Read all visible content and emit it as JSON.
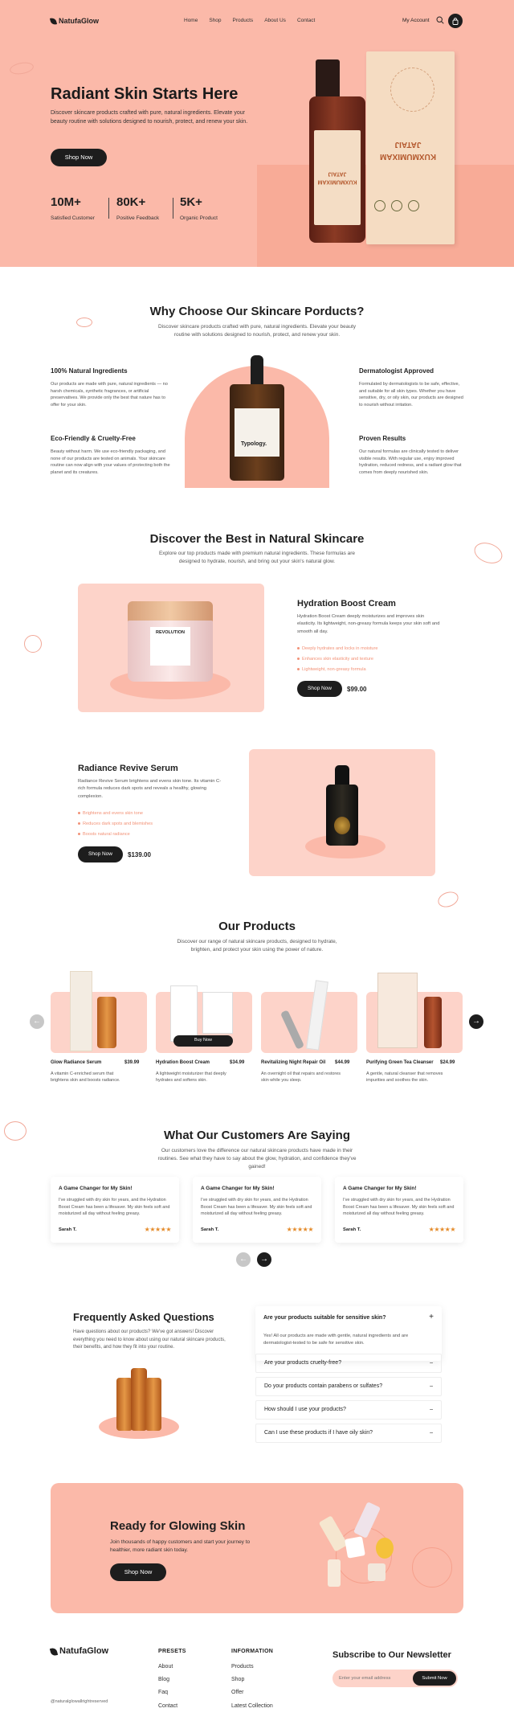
{
  "brand": "NatufaGlow",
  "nav": {
    "links": [
      "Home",
      "Shop",
      "Products",
      "About Us",
      "Contact"
    ],
    "account": "My Account"
  },
  "hero": {
    "title": "Radiant Skin Starts Here",
    "desc": "Discover skincare products crafted with pure, natural ingredients. Elevate your beauty routine with solutions designed to nourish, protect, and renew your skin.",
    "cta": "Shop Now",
    "stats": [
      {
        "num": "10M+",
        "label": "Satisfied  Customer"
      },
      {
        "num": "80K+",
        "label": "Positive Feedback"
      },
      {
        "num": "5K+",
        "label": "Organic Product"
      }
    ],
    "box_text": "KUXMUMIXAM JATAIJ"
  },
  "why": {
    "title": "Why Choose Our Skincare Porducts?",
    "sub": "Discover skincare products crafted with pure, natural ingredients. Elevate your beauty routine with solutions designed to nourish, protect, and renew your skin.",
    "features": [
      {
        "title": "100% Natural Ingredients",
        "text": "Our products are made with pure, natural ingredients — no harsh chemicals, synthetic fragrances, or artificial preservatives. We provide only the best that nature has to offer for your skin."
      },
      {
        "title": "Eco-Friendly & Cruelty-Free",
        "text": "Beauty without harm. We use eco-friendly packaging, and none of our products are tested on animals. Your skincare routine can now align with your values of protecting both the planet and its creatures."
      },
      {
        "title": "Dermatologist Approved",
        "text": "Formulated by dermatologists to be safe, effective, and suitable for all skin types. Whether you have sensitive, dry, or oily skin, our products are designed to nourish without irritation."
      },
      {
        "title": "Proven Results",
        "text": "Our natural formulas are clinically tested to deliver visible results. With regular use, enjoy improved hydration, reduced redness, and a radiant glow that comes from deeply nourished skin."
      }
    ],
    "bottle_label": "Typology."
  },
  "discover": {
    "title": "Discover the Best in Natural Skincare",
    "sub": "Explore our top products made with premium natural ingredients. These formulas are designed to hydrate, nourish, and bring out your skin's natural glow.",
    "items": [
      {
        "name": "Hydration Boost Cream",
        "desc": "Hydration Boost Cream deeply moisturizes and improves skin elasticity. Its lightweight, non-greasy formula keeps your skin soft and smooth all day.",
        "bullets": [
          "Deeply hydrates and locks in moisture",
          "Enhances skin elasticity and texture",
          "Lightweight, non-greasy formula"
        ],
        "cta": "Shop Now",
        "price": "$99.00",
        "jar_label": "REVOLUTION"
      },
      {
        "name": "Radiance Revive Serum",
        "desc": "Radiance Revive Serum brightens and evens skin tone. Its vitamin C-rich formula reduces dark spots and reveals a healthy, glowing complexion.",
        "bullets": [
          "Brightens and evens skin tone",
          "Reduces dark spots and blemishes",
          "Boosts natural radiance"
        ],
        "cta": "Shop Now",
        "price": "$139.00"
      }
    ]
  },
  "products": {
    "title": "Our Products",
    "sub": "Discover our range of natural skincare products, designed to hydrate, brighten, and protect your skin using the power of nature.",
    "buy": "Buy Now",
    "items": [
      {
        "name": "Glow Radiance Serum",
        "price": "$39.99",
        "desc": "A vitamin C-enriched serum that brightens skin and boosts radiance."
      },
      {
        "name": "Hydration Boost Cream",
        "price": "$34.99",
        "desc": "A lightweight moisturizer that deeply hydrates and softens skin."
      },
      {
        "name": "Revitalizing Night Repair Oil",
        "price": "$44.99",
        "desc": "An overnight oil that repairs and restores skin while you sleep."
      },
      {
        "name": "Purifying Green Tea Cleanser",
        "price": "$24.99",
        "desc": "A gentle, natural cleanser that removes impurities and soothes the skin."
      }
    ]
  },
  "reviews": {
    "title": "What Our Customers Are Saying",
    "sub": "Our customers love the difference our natural skincare products have made in their routines. See what they have to say about the glow, hydration, and confidence they've gained!",
    "items": [
      {
        "title": "A Game Changer for My Skin!",
        "text": "I've struggled with dry skin for years, and the Hydration Boost Cream has been a lifesaver. My skin feels soft and moisturized all day without feeling greasy.",
        "who": "Sarah T.",
        "stars": "★★★★★"
      },
      {
        "title": "A Game Changer for My Skin!",
        "text": "I've struggled with dry skin for years, and the Hydration Boost Cream has been a lifesaver. My skin feels soft and moisturized all day without feeling greasy.",
        "who": "Sarah T.",
        "stars": "★★★★★"
      },
      {
        "title": "A Game Changer for My Skin!",
        "text": "I've struggled with dry skin for years, and the Hydration Boost Cream has been a lifesaver. My skin feels soft and moisturized all day without feeling greasy.",
        "who": "Sarah T.",
        "stars": "★★★★★"
      }
    ]
  },
  "faq": {
    "title": "Frequently Asked Questions",
    "sub": "Have questions about our products? We've got answers! Discover everything you need to know about using our natural skincare products, their benefits, and how they fit into your routine.",
    "open_q": "Are your products suitable for sensitive skin?",
    "open_a": "Yes! All our products are made with gentle, natural ingredients and are dermatologist-tested to be safe for sensitive skin.",
    "questions": [
      "Are your products cruelty-free?",
      "Do your products contain parabens or sulfates?",
      "How should I use your products?",
      "Can I use these products if I have oily skin?"
    ]
  },
  "cta": {
    "title": "Ready for Glowing Skin",
    "text": "Join thousands of happy customers and start your journey to healthier, more radiant skin today.",
    "btn": "Shop Now"
  },
  "footer": {
    "copyright": "@naturalglowallrightreserved",
    "col1": {
      "title": "PRESETS",
      "links": [
        "About",
        "Blog",
        "Faq",
        "Contact"
      ]
    },
    "col2": {
      "title": "INFORMATION",
      "links": [
        "Products",
        "Shop",
        "Offer",
        "Latest Collection"
      ]
    },
    "newsletter": {
      "title": "Subscribe to Our Newsletter",
      "placeholder": "Enter your email address",
      "btn": "Submit Now"
    }
  },
  "colors": {
    "pink": "#fbb9a9",
    "light_pink": "#fdd3c9",
    "orange_text": "#f29277",
    "dark": "#1d1d1d"
  }
}
